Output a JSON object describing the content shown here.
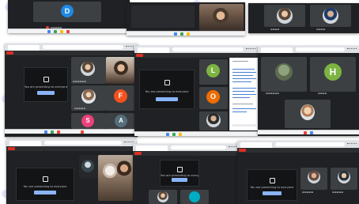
{
  "windows": [
    {
      "id": "w1",
      "meeting_label": "",
      "presenting_text": "",
      "participants": [
        {
          "initial": "D",
          "color": "#1e88e5"
        }
      ]
    },
    {
      "id": "w2",
      "meeting_label": "",
      "presenting_text": "",
      "participants": []
    },
    {
      "id": "w3",
      "meeting_label": "",
      "presenting_text": "",
      "participants": []
    },
    {
      "id": "w4",
      "meeting_label": "",
      "presenting_text": "You are presenting to everyone",
      "participants": [
        {
          "initial": "F",
          "color": "#f4511e"
        },
        {
          "initial": "S",
          "color": "#ec407a"
        },
        {
          "initial": "A",
          "color": "#546e7a"
        }
      ]
    },
    {
      "id": "w5",
      "meeting_label": "",
      "presenting_text": "You are presenting to everyone",
      "participants": [
        {
          "initial": "L",
          "color": "#7cb342"
        },
        {
          "initial": "O",
          "color": "#ef6c00"
        }
      ]
    },
    {
      "id": "w6",
      "meeting_label": "",
      "presenting_text": "",
      "participants": [
        {
          "initial": "H",
          "color": "#7cb342"
        }
      ]
    },
    {
      "id": "w7",
      "meeting_label": "",
      "presenting_text": "You are presenting to everyone",
      "participants": []
    },
    {
      "id": "w8",
      "meeting_label": "",
      "presenting_text": "You are presenting to everyone",
      "participants": [
        {
          "initial": "",
          "color": "#00acc1"
        }
      ]
    },
    {
      "id": "w9",
      "meeting_label": "",
      "presenting_text": "You are presenting to everyone",
      "participants": []
    }
  ],
  "colors": {
    "meet_bg": "#202124",
    "recording_red": "#d93025",
    "present_button": "#8ab4f8",
    "mic_off": "#ea4335"
  }
}
